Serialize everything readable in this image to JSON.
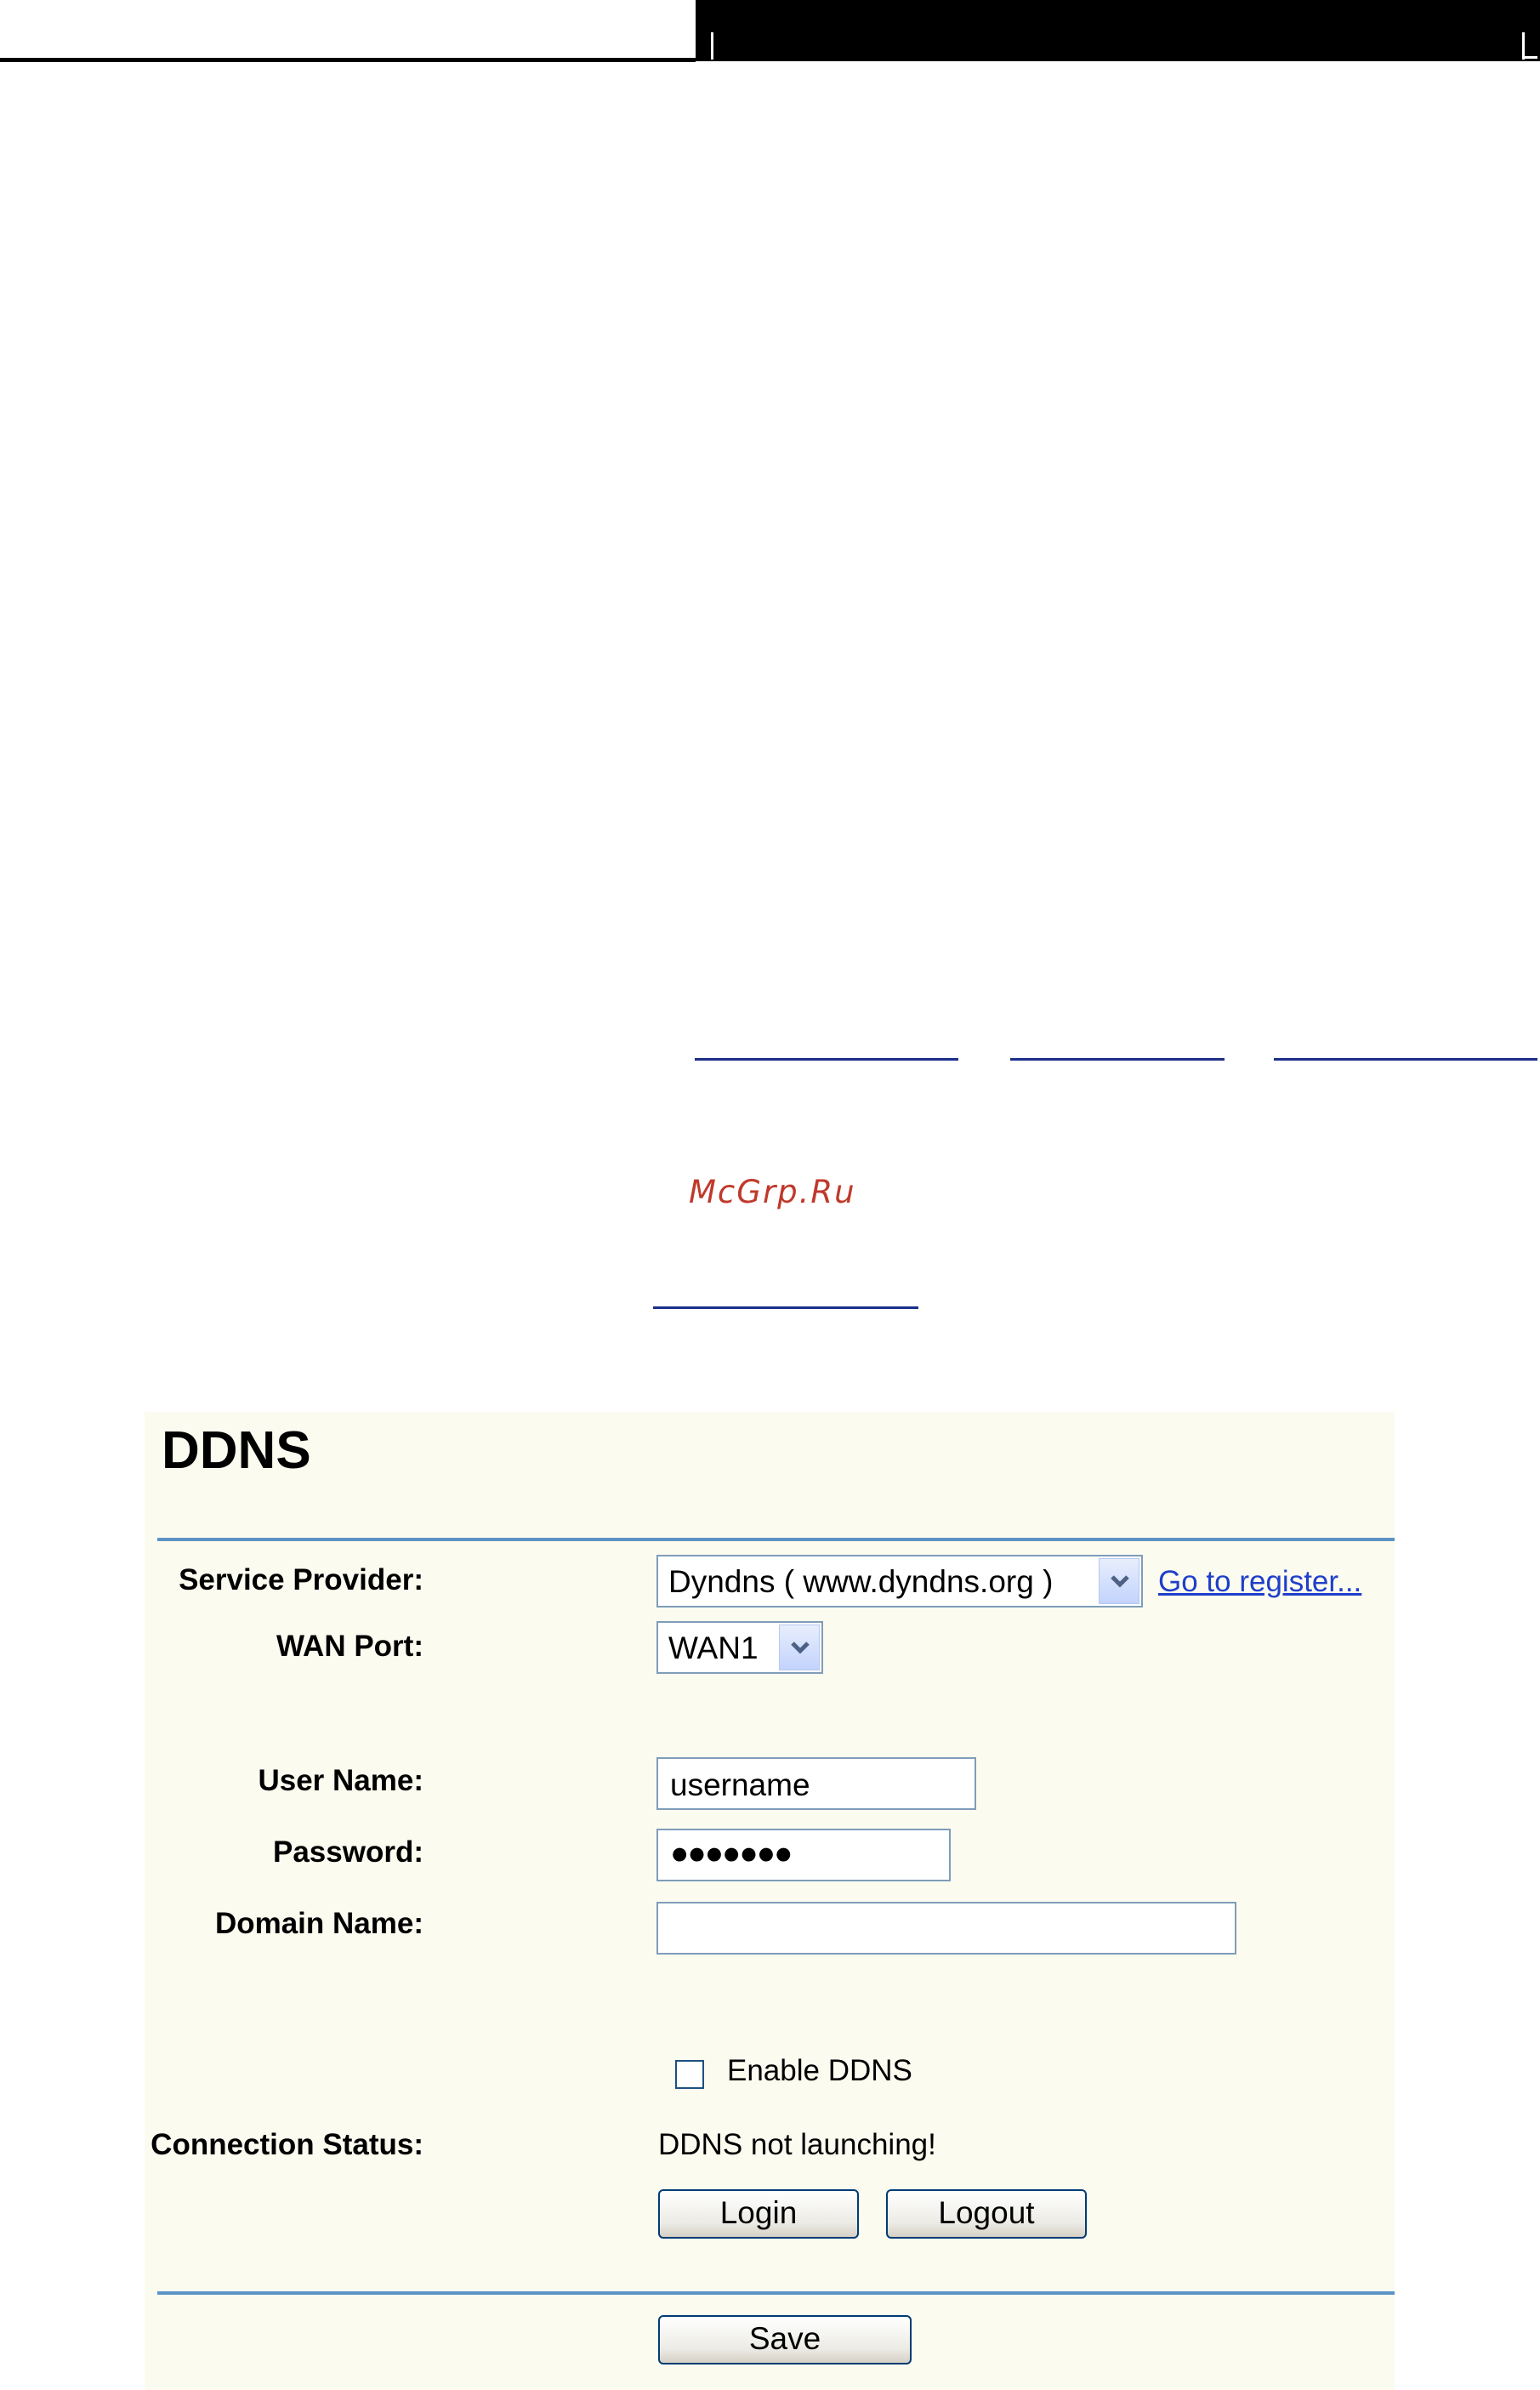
{
  "watermark": "McGrp.Ru",
  "ddns": {
    "title": "DDNS",
    "service_provider": {
      "label": "Service Provider:",
      "selected": "Dyndns ( www.dyndns.org )",
      "register_link": "Go to register..."
    },
    "wan_port": {
      "label": "WAN Port:",
      "selected": "WAN1"
    },
    "user_name": {
      "label": "User Name:",
      "value": "username"
    },
    "password": {
      "label": "Password:",
      "value": "●●●●●●●"
    },
    "domain_name": {
      "label": "Domain Name:",
      "value": ""
    },
    "enable_ddns": {
      "label": "Enable DDNS",
      "checked": false
    },
    "connection_status": {
      "label": "Connection Status:",
      "value": "DDNS not launching!"
    },
    "buttons": {
      "login": "Login",
      "logout": "Logout",
      "save": "Save"
    }
  },
  "colors": {
    "panel_bg": "#fbfbf0",
    "rule": "#5c93c5",
    "link": "#1f3fc9",
    "watermark": "#c0392b"
  }
}
